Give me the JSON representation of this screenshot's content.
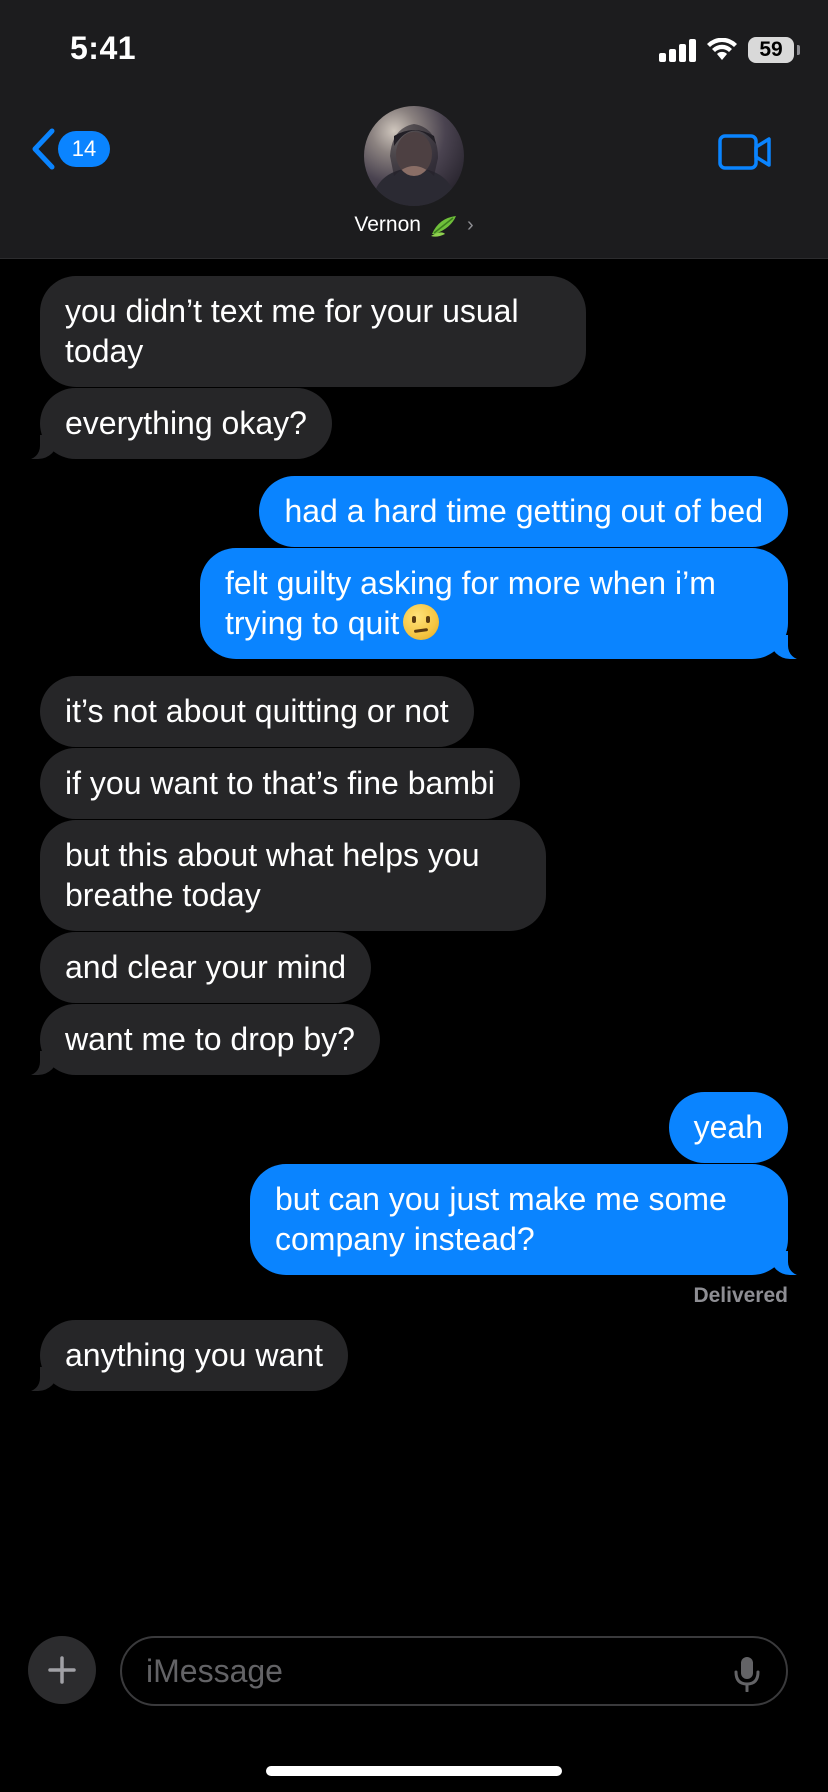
{
  "status_bar": {
    "time": "5:41",
    "battery": "59"
  },
  "header": {
    "back_count": "14",
    "contact_name": "Vernon",
    "contact_emoji_icon": "herb-leaf-icon",
    "video_icon": "video-camera-icon"
  },
  "messages": [
    {
      "side": "incoming",
      "text": "you didn’t text me for your usual today"
    },
    {
      "side": "incoming",
      "text": "everything okay?"
    },
    {
      "side": "outgoing",
      "text": "had a hard time getting out of bed"
    },
    {
      "side": "outgoing",
      "text": "felt guilty asking for more when i’m trying to quit"
    },
    {
      "side": "incoming",
      "text": "it’s not about quitting or not"
    },
    {
      "side": "incoming",
      "text": "if you want to that’s fine bambi"
    },
    {
      "side": "incoming",
      "text": "but this about what helps you breathe today"
    },
    {
      "side": "incoming",
      "text": "and clear your mind"
    },
    {
      "side": "incoming",
      "text": "want me to drop by?"
    },
    {
      "side": "outgoing",
      "text": "yeah"
    },
    {
      "side": "outgoing",
      "text": "but can you just make me some company instead?"
    },
    {
      "side": "incoming",
      "text": "anything you want"
    }
  ],
  "emoji_in_message_4": "confused-face-emoji",
  "delivery_status": "Delivered",
  "composer": {
    "placeholder": "iMessage"
  },
  "colors": {
    "outgoing": "#0a84ff",
    "incoming": "#262628",
    "background": "#000000"
  }
}
